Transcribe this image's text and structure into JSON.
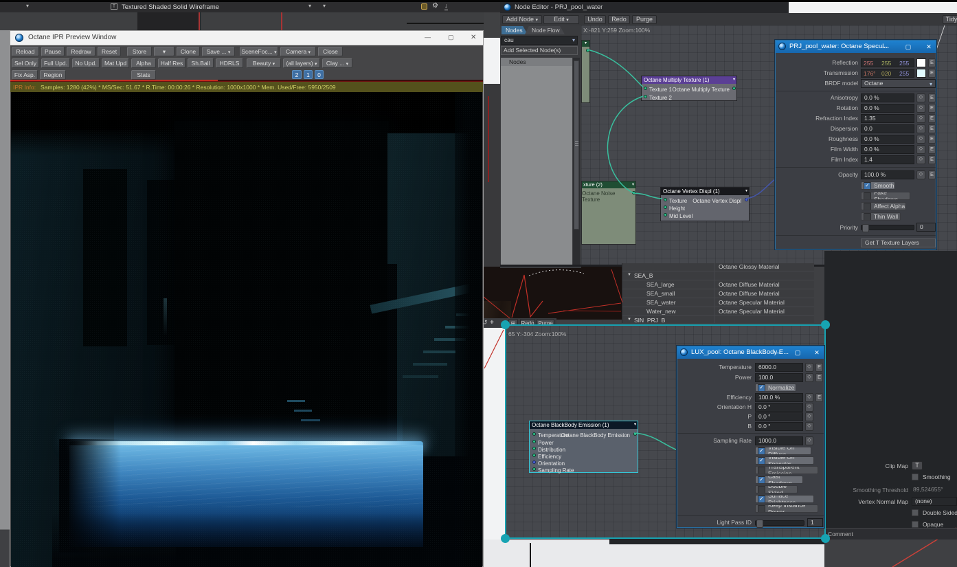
{
  "glyphs": {
    "e": "E",
    "check": "✓",
    "chevron": "▾",
    "minimize": "—",
    "maximize": "▢",
    "close": "✕",
    "gear": "⚙",
    "undo_arrow": "↺",
    "pan_cross": "+",
    "grid_icon": "⊞",
    "down_arrow": "↓"
  },
  "lw": {
    "viewport_mode": "Textured Shaded Solid Wireframe",
    "tidy": "Tidy"
  },
  "ipr": {
    "title": "Octane IPR Preview Window",
    "r1": [
      "Reload",
      "Pause",
      "Redraw",
      "Reset",
      "Store",
      "Clone",
      "Save ...",
      "SceneFoc...",
      "Camera",
      "Close"
    ],
    "r2": [
      "Sel Only",
      "Full Upd.",
      "No Upd.",
      "Mat Upd",
      "Alpha",
      "Half Res",
      "Sh.Ball",
      "HDRLS",
      "Beauty",
      "(all layers)",
      "Clay ..."
    ],
    "r3": [
      "Fix Asp.",
      "Region",
      "Stats",
      "2",
      "1",
      "0"
    ],
    "info_label": "IPR Info:",
    "info": "Samples: 1280 (42%)  *  MS/Sec: 51.67  *  R.Time: 00:00:26  *  Resolution: 1000x1000  *  Mem. Used/Free: 5950/2509"
  },
  "ne": {
    "title": "Node Editor - PRJ_pool_water",
    "add_node": "Add Node",
    "edit": "Edit",
    "undo": "Undo",
    "redo": "Redo",
    "purge": "Purge",
    "tab_nodes": "Nodes",
    "tab_flow": "Node Flow",
    "filter": "cau",
    "add_selected": "Add Selected Node(s)",
    "list_header": "Nodes",
    "coords": "X:-821 Y:259 Zoom:100%"
  },
  "ne2": {
    "coords": "65 Y:-304 Zoom:100%",
    "btn1": "Redo",
    "btn2": "Purge"
  },
  "nodes": {
    "multiply": {
      "title": "Octane Multiply Texture (1)",
      "in1": "Texture 1",
      "in2": "Texture 2",
      "out": "Octane Multiply Texture"
    },
    "noise": {
      "title": "xture (2)",
      "out": "Octane Noise Texture"
    },
    "vertex": {
      "title": "Octane Vertex Displ (1)",
      "in1": "Texture",
      "in2": "Height",
      "in3": "Mid Level",
      "out": "Octane Vertex Displ"
    },
    "blackbody": {
      "title": "Octane BlackBody Emission (1)",
      "in1": "Temperature",
      "in2": "Power",
      "in3": "Distribution",
      "in4": "Efficiency",
      "in5": "Orientation",
      "in6": "Sampling Rate",
      "out": "Octane BlackBody Emission"
    }
  },
  "spec": {
    "title": "PRJ_pool_water: Octane Specul...",
    "reflection": {
      "label": "Reflection",
      "r": "255",
      "g": "255",
      "b": "255",
      "swatch": "#ffffff"
    },
    "transmission": {
      "label": "Transmission",
      "r": "176°",
      "g": "020",
      "b": "255",
      "swatch": "#e2fbff"
    },
    "brdf": {
      "label": "BRDF model",
      "value": "Octane"
    },
    "rows": [
      {
        "label": "Anisotropy",
        "value": "0.0 %"
      },
      {
        "label": "Rotation",
        "value": "0.0 %"
      },
      {
        "label": "Refraction Index",
        "value": "1.35"
      },
      {
        "label": "Dispersion",
        "value": "0.0"
      },
      {
        "label": "Roughness",
        "value": "0.0 %"
      },
      {
        "label": "Film Width",
        "value": "0.0 %"
      },
      {
        "label": "Film Index",
        "value": "1.4"
      },
      {
        "label": "Opacity",
        "value": "100.0 %"
      }
    ],
    "checks": [
      {
        "label": "Smooth",
        "on": true
      },
      {
        "label": "Fake Shadows",
        "on": false
      },
      {
        "label": "Affect Alpha",
        "on": false
      },
      {
        "label": "Thin Wall",
        "on": false
      }
    ],
    "priority": "Priority",
    "priority_value": "0",
    "get_t": "Get T Texture Layers"
  },
  "lux": {
    "title": "LUX_pool: Octane BlackBody E...",
    "rows": [
      {
        "label": "Temperature",
        "value": "6000.0"
      },
      {
        "label": "Power",
        "value": "100.0"
      },
      {
        "label": "Efficiency",
        "value": "100.0 %"
      },
      {
        "label": "Orientation H",
        "value": "0.0 °"
      },
      {
        "label": "P",
        "value": "0.0 °"
      },
      {
        "label": "B",
        "value": "0.0 °"
      },
      {
        "label": "Sampling Rate",
        "value": "1000.0"
      }
    ],
    "normalize": "Normalize",
    "checks": [
      {
        "label": "Visible On Diffuse",
        "on": true
      },
      {
        "label": "Visible On Specular",
        "on": true
      },
      {
        "label": "Transparent Emission",
        "on": false
      },
      {
        "label": "Cast Shadows",
        "on": true
      },
      {
        "label": "Double Sided",
        "on": false
      },
      {
        "label": "Surface Brightness",
        "on": true
      },
      {
        "label": "Keep Instance Power",
        "on": false
      }
    ],
    "light_pass": "Light Pass ID",
    "light_pass_value": "1"
  },
  "surfaces": {
    "partial_type": "Octane Glossy Material",
    "group1": "SEA_B",
    "items": [
      {
        "name": "SEA_large",
        "type": "Octane Diffuse Material"
      },
      {
        "name": "SEA_small",
        "type": "Octane Diffuse Material"
      },
      {
        "name": "SEA_water",
        "type": "Octane Specular Material"
      },
      {
        "name": "Water_new",
        "type": "Octane Specular Material"
      }
    ],
    "group2": "SIN_PRJ_B"
  },
  "props": {
    "clip_map": "Clip Map",
    "t": "T",
    "smoothing": "Smoothing",
    "smoothing_threshold": "Smoothing Threshold",
    "smoothing_threshold_value": "89,524655°",
    "vertex_normal_map": "Vertex Normal Map",
    "vertex_normal_value": "(none)",
    "double_sided": "Double Sided",
    "opaque": "Opaque",
    "comment": "Comment"
  }
}
